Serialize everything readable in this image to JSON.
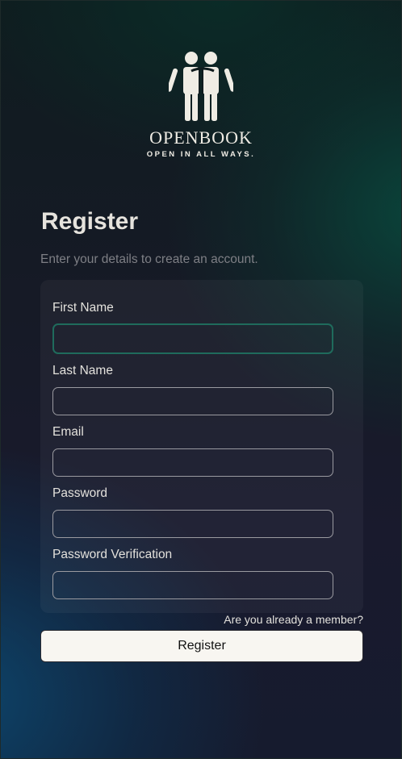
{
  "brand": {
    "logo_icon": "two-people-icon",
    "name": "OPENBOOK",
    "tagline": "OPEN IN ALL WAYS."
  },
  "header": {
    "title": "Register",
    "subtitle": "Enter your details to create an account."
  },
  "form": {
    "fields": [
      {
        "label": "First Name",
        "value": "",
        "focused": true
      },
      {
        "label": "Last Name",
        "value": ""
      },
      {
        "label": "Email",
        "value": ""
      },
      {
        "label": "Password",
        "value": ""
      },
      {
        "label": "Password Verification",
        "value": ""
      }
    ],
    "member_link": "Are you already a member?",
    "submit_label": "Register"
  },
  "colors": {
    "focus_border": "#1f6b5c",
    "button_bg": "#f8f6f1",
    "subtitle": "#7e7f85"
  }
}
